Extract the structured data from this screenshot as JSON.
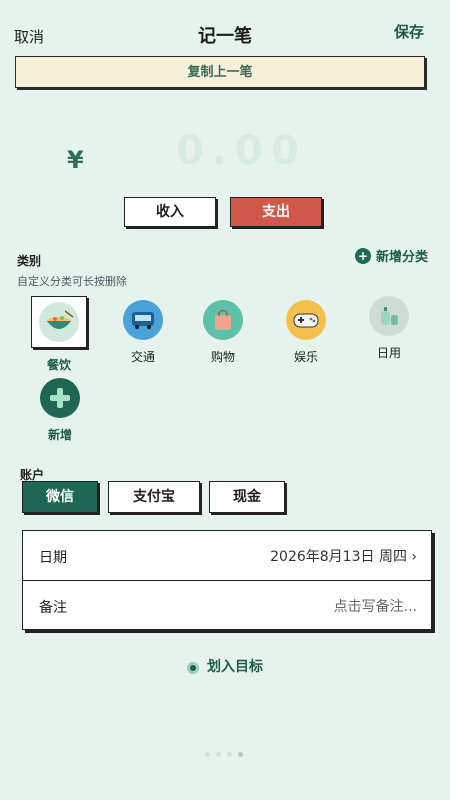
{
  "header": {
    "cancel": "取消",
    "title": "记一笔",
    "save": "保存"
  },
  "copy_last": "复制上一笔",
  "amount": {
    "currency": "¥",
    "value": "0.00"
  },
  "type_toggle": {
    "income": "收入",
    "expense": "支出",
    "selected": "支出"
  },
  "category": {
    "label": "类别",
    "hint": "自定义分类可长按删除",
    "add_label": "新增分类",
    "items": [
      {
        "label": "餐饮",
        "icon": "bowl-icon",
        "selected": true
      },
      {
        "label": "交通",
        "icon": "bus-icon"
      },
      {
        "label": "购物",
        "icon": "shopping-bag-icon"
      },
      {
        "label": "娱乐",
        "icon": "gamepad-icon"
      },
      {
        "label": "日用",
        "icon": "daily-goods-icon"
      },
      {
        "label": "新增",
        "icon": "plus-icon"
      }
    ]
  },
  "account": {
    "label": "账户",
    "options": [
      "微信",
      "支付宝",
      "现金"
    ],
    "selected": "微信"
  },
  "details": {
    "date_label": "日期",
    "date_value": "2026年8月13日  周四 ›",
    "note_label": "备注",
    "note_placeholder": "点击写备注..."
  },
  "target_link": "划入目标",
  "colors": {
    "accent": "#1c5c4b",
    "expense": "#d0584b",
    "background": "#e6f3ec"
  }
}
